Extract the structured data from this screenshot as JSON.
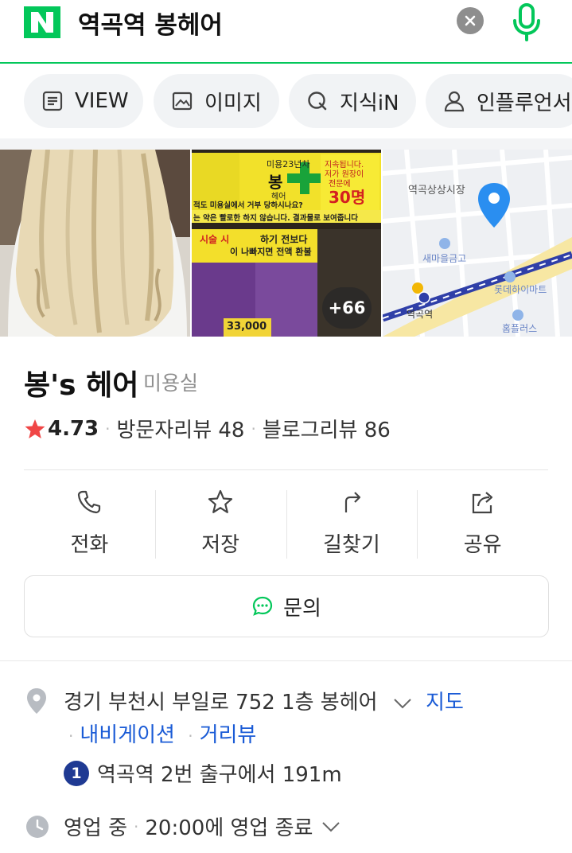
{
  "search": {
    "query": "역곡역 봉헤어"
  },
  "tabs": [
    {
      "label": "VIEW",
      "icon": "document-icon"
    },
    {
      "label": "이미지",
      "icon": "image-icon"
    },
    {
      "label": "지식iN",
      "icon": "q-icon"
    },
    {
      "label": "인플루언서",
      "icon": "person-icon"
    }
  ],
  "gallery": {
    "photo2_text": {
      "line1": "미용23년차",
      "line2": "봉",
      "line3": "헤어",
      "notice1": "지속됩니다.",
      "notice2": "저가 원장이",
      "notice3": "전문에",
      "big_price": "30명",
      "slogan": "적도 미용실에서 거부 당하시나요?",
      "slogan2": "는 약은 빨로한 하지 않습니다. 결과물로 보여줍니다",
      "promo1": "시술 시",
      "promo2": "하기 전보다",
      "promo3": "이 나빠지면 전액 환불",
      "price_bottom": "33,000"
    },
    "more_count": "+66",
    "map_labels": {
      "market": "역곡상상시장",
      "bank": "새마을금고",
      "mart": "롯데하이마트",
      "station": "역곡역",
      "homeplus": "홈플러스"
    }
  },
  "place": {
    "name": "봉's 헤어",
    "category": "미용실",
    "rating": "4.73",
    "visitor_reviews": "방문자리뷰 48",
    "blog_reviews": "블로그리뷰 86"
  },
  "actions": [
    {
      "label": "전화",
      "icon": "phone-icon"
    },
    {
      "label": "저장",
      "icon": "star-outline-icon"
    },
    {
      "label": "길찾기",
      "icon": "directions-icon"
    },
    {
      "label": "공유",
      "icon": "share-icon"
    }
  ],
  "inquiry": {
    "label": "문의"
  },
  "address": {
    "text": "경기 부천시 부일로 752 1층 봉헤어",
    "map_link": "지도",
    "navigation_link": "내비게이션",
    "streetview_link": "거리뷰",
    "subway_line": "1",
    "subway_text": "역곡역 2번 출구에서 191m"
  },
  "hours": {
    "status": "영업 중",
    "closing": "20:00에 영업 종료"
  },
  "colors": {
    "naver_green": "#03c75a",
    "link_blue": "#1a5bd6",
    "star_red": "#f04646",
    "subway_line1": "#1f3a93"
  }
}
